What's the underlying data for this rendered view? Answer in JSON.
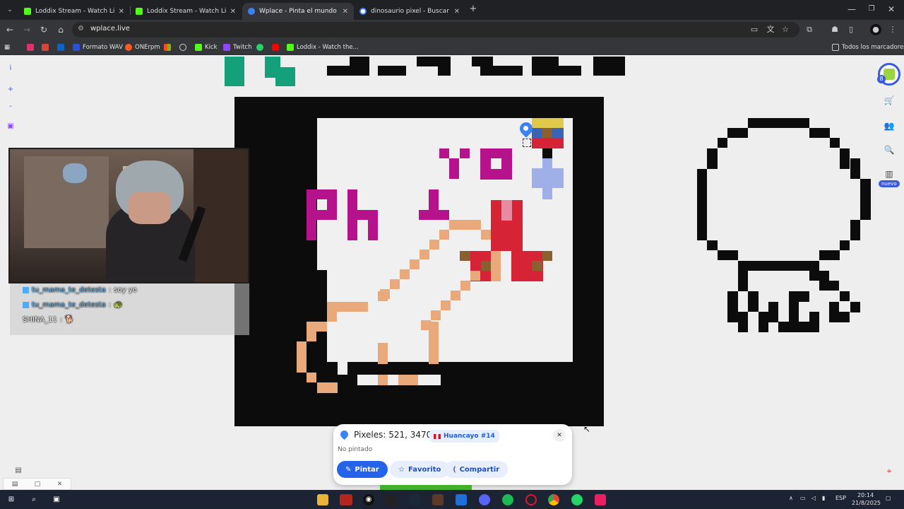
{
  "tabs": [
    {
      "title": "Loddix Stream - Watch Live on Kick",
      "color": "#53fc18",
      "active": false
    },
    {
      "title": "Loddix Stream - Watch Live on Kick",
      "color": "#53fc18",
      "active": false
    },
    {
      "title": "Wplace - Pinta el mundo",
      "color": "#3b82f6",
      "active": true
    },
    {
      "title": "dinosaurio pixel - Buscar con Google",
      "color": "#4285f4",
      "active": false
    }
  ],
  "new_tab_label": "+",
  "address": {
    "url": "wplace.live"
  },
  "bookmarks": [
    {
      "label": "Formato WAV",
      "color": "#2a4fd8"
    },
    {
      "label": "ONErpm",
      "color": "#ff5a1f"
    },
    {
      "label": "Kick",
      "color": "#53fc18"
    },
    {
      "label": "Twitch",
      "color": "#9146ff"
    },
    {
      "label": "Loddix - Watch the...",
      "color": "#53fc18"
    }
  ],
  "bookmarks_all": "Todos los marcadores",
  "canvas_text": {
    "yo": "YO",
    "ph": "Ph"
  },
  "left_toolbar": {
    "info": "i",
    "zoom_in": "+",
    "zoom_out": "-"
  },
  "right_toolbar": {
    "badge_count": "8",
    "new_badge": "nuevo"
  },
  "chat": [
    {
      "user": "tu_mama_te_detesta",
      "sep": ":",
      "msg": "soy yo"
    },
    {
      "user": "tu_mama_te_detesta",
      "sep": ":",
      "msg": "🐢"
    },
    {
      "user": "SHINA_11",
      "sep": ":",
      "msg": "🐕"
    }
  ],
  "popup": {
    "pixel_label": "Pixeles: 521, 3470",
    "region": "Huancayo #14",
    "status": "No pintado",
    "paint": "Pintar",
    "favorite": "Favorito",
    "share": "Compartir"
  },
  "taskbar": {
    "lang": "ESP",
    "time": "20:14",
    "date": "21/8/2025"
  },
  "colors": {
    "black": "#0c0c0c",
    "white": "#f0f0f0",
    "magenta": "#b5128c",
    "peach": "#e9a97a",
    "red": "#d62436",
    "pink": "#e88aa0",
    "brown": "#8a6030",
    "lavender": "#9fb0e8",
    "yellow": "#e0c84a",
    "blue": "#3a62b5",
    "green": "#13a07a"
  }
}
